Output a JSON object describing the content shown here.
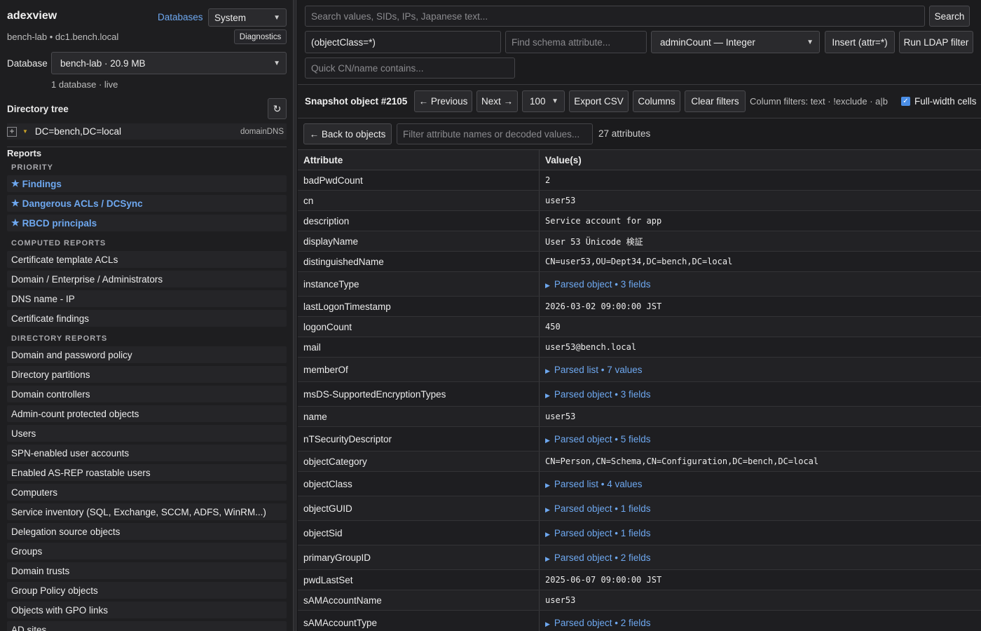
{
  "sidebar": {
    "brand": "adexview",
    "databases_link": "Databases",
    "theme_select": "System",
    "host": "bench-lab • dc1.bench.local",
    "diagnostics_button": "Diagnostics",
    "database_label": "Database",
    "database_select": "bench-lab · 20.9 MB",
    "database_count": "1 database · live",
    "tree_title": "Directory tree",
    "tree_root": {
      "dn": "DC=bench,DC=local",
      "type": "domainDNS"
    },
    "reports_title": "Reports",
    "priority_label": "PRIORITY",
    "priority_items": [
      "Findings",
      "Dangerous ACLs / DCSync",
      "RBCD principals"
    ],
    "computed_label": "COMPUTED REPORTS",
    "computed_items": [
      "Certificate template ACLs",
      "Domain / Enterprise / Administrators",
      "DNS name - IP",
      "Certificate findings"
    ],
    "directory_label": "DIRECTORY REPORTS",
    "directory_items": [
      "Domain and password policy",
      "Directory partitions",
      "Domain controllers",
      "Admin-count protected objects",
      "Users",
      "SPN-enabled user accounts",
      "Enabled AS-REP roastable users",
      "Computers",
      "Service inventory (SQL, Exchange, SCCM, ADFS, WinRM...)",
      "Delegation source objects",
      "Groups",
      "Domain trusts",
      "Group Policy objects",
      "Objects with GPO links",
      "AD sites"
    ]
  },
  "search": {
    "placeholder": "Search values, SIDs, IPs, Japanese text...",
    "button": "Search"
  },
  "ldap": {
    "filter_value": "(objectClass=*)",
    "schema_placeholder": "Find schema attribute...",
    "attribute_select": "adminCount — Integer",
    "insert_button": "Insert (attr=*)",
    "run_button": "Run LDAP filter",
    "quick_placeholder": "Quick CN/name contains..."
  },
  "toolbar": {
    "snapshot_title": "Snapshot object #2105",
    "previous": "← Previous",
    "next": "Next →",
    "page_size": "100",
    "export": "Export CSV",
    "columns": "Columns",
    "clear_filters": "Clear filters",
    "column_filters_hint": "Column filters: text · !exclude · a|b",
    "full_width": "Full-width cells"
  },
  "detail": {
    "back": "← Back to objects",
    "filter_placeholder": "Filter attribute names or decoded values...",
    "attr_count": "27 attributes",
    "col_attribute": "Attribute",
    "col_values": "Value(s)"
  },
  "rows": [
    {
      "attr": "badPwdCount",
      "value": "2"
    },
    {
      "attr": "cn",
      "value": "user53"
    },
    {
      "attr": "description",
      "value": "Service account for app"
    },
    {
      "attr": "displayName",
      "value": "User 53 Ünicode 検証"
    },
    {
      "attr": "distinguishedName",
      "value": "CN=user53,OU=Dept34,DC=bench,DC=local"
    },
    {
      "attr": "instanceType",
      "parsed": "Parsed object",
      "count": "3 fields"
    },
    {
      "attr": "lastLogonTimestamp",
      "value": "2026-03-02 09:00:00 JST"
    },
    {
      "attr": "logonCount",
      "value": "450"
    },
    {
      "attr": "mail",
      "value": "user53@bench.local"
    },
    {
      "attr": "memberOf",
      "parsed": "Parsed list",
      "count": "7 values"
    },
    {
      "attr": "msDS-SupportedEncryptionTypes",
      "parsed": "Parsed object",
      "count": "3 fields"
    },
    {
      "attr": "name",
      "value": "user53"
    },
    {
      "attr": "nTSecurityDescriptor",
      "parsed": "Parsed object",
      "count": "5 fields"
    },
    {
      "attr": "objectCategory",
      "value": "CN=Person,CN=Schema,CN=Configuration,DC=bench,DC=local"
    },
    {
      "attr": "objectClass",
      "parsed": "Parsed list",
      "count": "4 values"
    },
    {
      "attr": "objectGUID",
      "parsed": "Parsed object",
      "count": "1 fields"
    },
    {
      "attr": "objectSid",
      "parsed": "Parsed object",
      "count": "1 fields"
    },
    {
      "attr": "primaryGroupID",
      "parsed": "Parsed object",
      "count": "2 fields"
    },
    {
      "attr": "pwdLastSet",
      "value": "2025-06-07 09:00:00 JST"
    },
    {
      "attr": "sAMAccountName",
      "value": "user53"
    },
    {
      "attr": "sAMAccountType",
      "parsed": "Parsed object",
      "count": "2 fields"
    }
  ]
}
